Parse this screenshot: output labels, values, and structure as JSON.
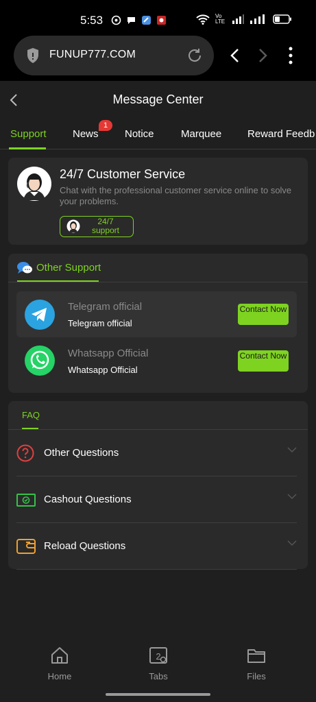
{
  "status_bar": {
    "time": "5:53",
    "volte_label": "Vo LTE"
  },
  "browser": {
    "url": "FUNUP777.COM"
  },
  "header": {
    "title": "Message Center"
  },
  "tabs": [
    {
      "label": "Support",
      "active": true
    },
    {
      "label": "News",
      "badge": "1"
    },
    {
      "label": "Notice"
    },
    {
      "label": "Marquee"
    },
    {
      "label": "Reward Feedb"
    }
  ],
  "customer_service": {
    "title": "24/7 Customer Service",
    "description": "Chat with the professional customer service online to solve your problems.",
    "button_label": "24/7 support"
  },
  "other_support": {
    "label": "Other Support",
    "items": [
      {
        "title": "Telegram official",
        "subtitle": "Telegram official",
        "button": "Contact Now"
      },
      {
        "title": "Whatsapp Official",
        "subtitle": "Whatsapp Official",
        "button": "Contact Now"
      }
    ]
  },
  "faq": {
    "label": "FAQ",
    "items": [
      {
        "label": "Other Questions",
        "icon": "question-circle-icon"
      },
      {
        "label": "Cashout Questions",
        "icon": "cash-icon"
      },
      {
        "label": "Reload Questions",
        "icon": "wallet-icon"
      }
    ]
  },
  "bottom_nav": {
    "home": "Home",
    "tabs": "Tabs",
    "tabs_count": "2",
    "files": "Files"
  },
  "colors": {
    "accent": "#7ed321",
    "background": "#1f1f1f",
    "card": "#2a2a2a",
    "badge": "#e53935"
  }
}
